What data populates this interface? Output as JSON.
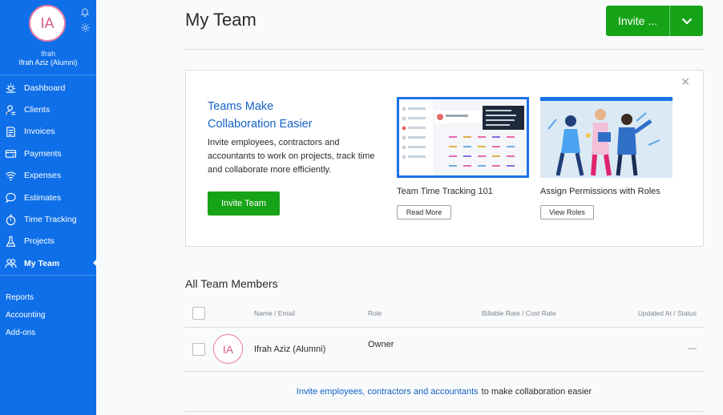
{
  "sidebar": {
    "avatar_initials": "IA",
    "user_first": "Ifrah",
    "user_full": "Ifrah Aziz (Alumni)",
    "items": [
      {
        "label": "Dashboard",
        "icon": "dashboard-icon"
      },
      {
        "label": "Clients",
        "icon": "clients-icon"
      },
      {
        "label": "Invoices",
        "icon": "invoices-icon"
      },
      {
        "label": "Payments",
        "icon": "payments-icon"
      },
      {
        "label": "Expenses",
        "icon": "expenses-icon"
      },
      {
        "label": "Estimates",
        "icon": "estimates-icon"
      },
      {
        "label": "Time Tracking",
        "icon": "stopwatch-icon"
      },
      {
        "label": "Projects",
        "icon": "flask-icon"
      },
      {
        "label": "My Team",
        "icon": "team-icon",
        "active": true
      }
    ],
    "secondary": [
      "Reports",
      "Accounting",
      "Add-ons"
    ]
  },
  "header": {
    "title": "My Team",
    "invite_label": "Invite ..."
  },
  "promo": {
    "heading_line1": "Teams Make",
    "heading_line2": "Collaboration Easier",
    "body": "Invite employees, contractors and accountants to work on projects, track time and collaborate more efficiently.",
    "cta": "Invite Team",
    "cards": [
      {
        "title": "Team Time Tracking 101",
        "button": "Read More"
      },
      {
        "title": "Assign Permissions with Roles",
        "button": "View Roles"
      }
    ]
  },
  "members": {
    "section_title": "All Team Members",
    "columns": [
      "Name / Email",
      "Role",
      "Billable Rate / Cost Rate",
      "Updated At / Status"
    ],
    "rows": [
      {
        "initials": "IA",
        "name": "Ifrah Aziz (Alumni)",
        "role": "Owner",
        "status": "—"
      }
    ],
    "invite_link": "Invite employees, contractors and accountants",
    "invite_suffix": "to make collaboration easier"
  },
  "colors": {
    "sidebar": "#0f6fe8",
    "accent_green": "#17a317",
    "link_blue": "#1462c7",
    "avatar_pink": "#e67aa5"
  }
}
